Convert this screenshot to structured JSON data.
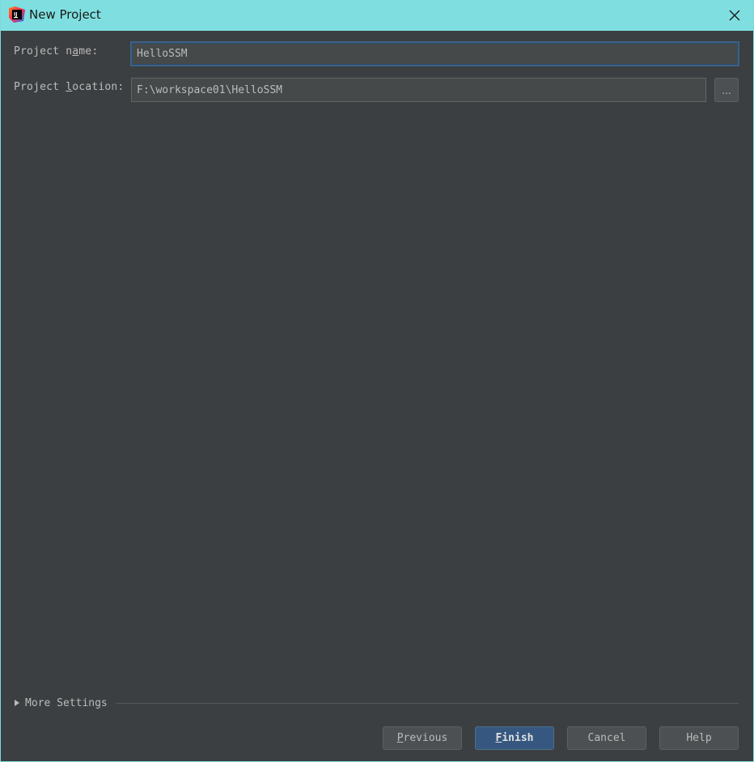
{
  "window": {
    "title": "New Project",
    "app_icon": "intellij-idea-icon",
    "close_icon": "close-icon"
  },
  "form": {
    "project_name": {
      "label_prefix": "Project n",
      "label_mnemonic": "a",
      "label_suffix": "me:",
      "value": "HelloSSM"
    },
    "project_location": {
      "label_prefix": "Project ",
      "label_mnemonic": "l",
      "label_suffix": "ocation:",
      "value": "F:\\workspace01\\HelloSSM",
      "browse_label": "..."
    }
  },
  "more_settings": {
    "label_prefix": "Mor",
    "label_mnemonic": "e",
    "label_suffix": " Settings",
    "expanded": false
  },
  "buttons": {
    "previous": {
      "mnemonic": "P",
      "rest": "revious"
    },
    "finish": {
      "mnemonic": "F",
      "rest": "inish"
    },
    "cancel": {
      "label": "Cancel"
    },
    "help": {
      "label": "Help"
    }
  },
  "colors": {
    "titlebar": "#7fdfe0",
    "background": "#3c3f41",
    "field_background": "#45494a",
    "focus_border": "#3d6185",
    "primary_button": "#365880",
    "text": "#bbbbbb"
  }
}
